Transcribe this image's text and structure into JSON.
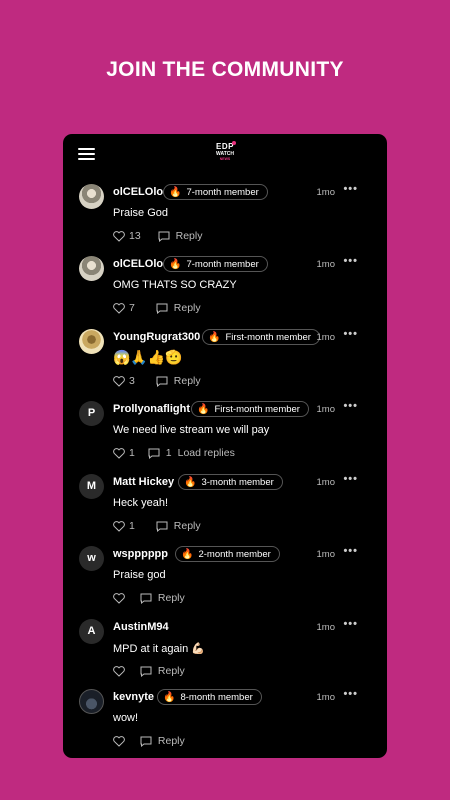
{
  "headline": "JOIN THE COMMUNITY",
  "logo": {
    "line1": "EDP",
    "line2": "WATCH",
    "line3": "NEWS"
  },
  "comments": [
    {
      "username": "olCELOlo",
      "badge": "7-month member",
      "time": "1mo",
      "text": "Praise God",
      "likes": "13",
      "reply_label": "Reply",
      "avatar": "photo-avatar"
    },
    {
      "username": "olCELOlo",
      "badge": "7-month member",
      "time": "1mo",
      "text": "OMG THATS SO CRAZY",
      "likes": "7",
      "reply_label": "Reply",
      "avatar": "photo-avatar"
    },
    {
      "username": "YoungRugrat300",
      "badge": "First-month member",
      "time": "1mo",
      "text": "😱🙏👍🫡",
      "likes": "3",
      "reply_label": "Reply",
      "avatar": "photo-avatar"
    },
    {
      "username": "Prollyonaflight",
      "badge": "First-month member",
      "time": "1mo",
      "text": "We need live stream we will pay",
      "likes": "1",
      "replies": "1",
      "load_label": "Load replies",
      "avatar_letter": "P"
    },
    {
      "username": "Matt Hickey",
      "badge": "3-month member",
      "time": "1mo",
      "text": "Heck yeah!",
      "likes": "1",
      "reply_label": "Reply",
      "avatar_letter": "M"
    },
    {
      "username": "wspppppp",
      "badge": "2-month member",
      "time": "1mo",
      "text": "Praise god",
      "reply_label": "Reply",
      "avatar_letter": "w"
    },
    {
      "username": "AustinM94",
      "time": "1mo",
      "text": "MPD at it again 💪🏻",
      "reply_label": "Reply",
      "avatar_letter": "A"
    },
    {
      "username": "kevnyte",
      "badge": "8-month member",
      "time": "1mo",
      "text": "wow!",
      "reply_label": "Reply",
      "avatar": "photo-avatar"
    }
  ],
  "more_icon": "ellipsis-icon",
  "badge_icon": "🔥"
}
